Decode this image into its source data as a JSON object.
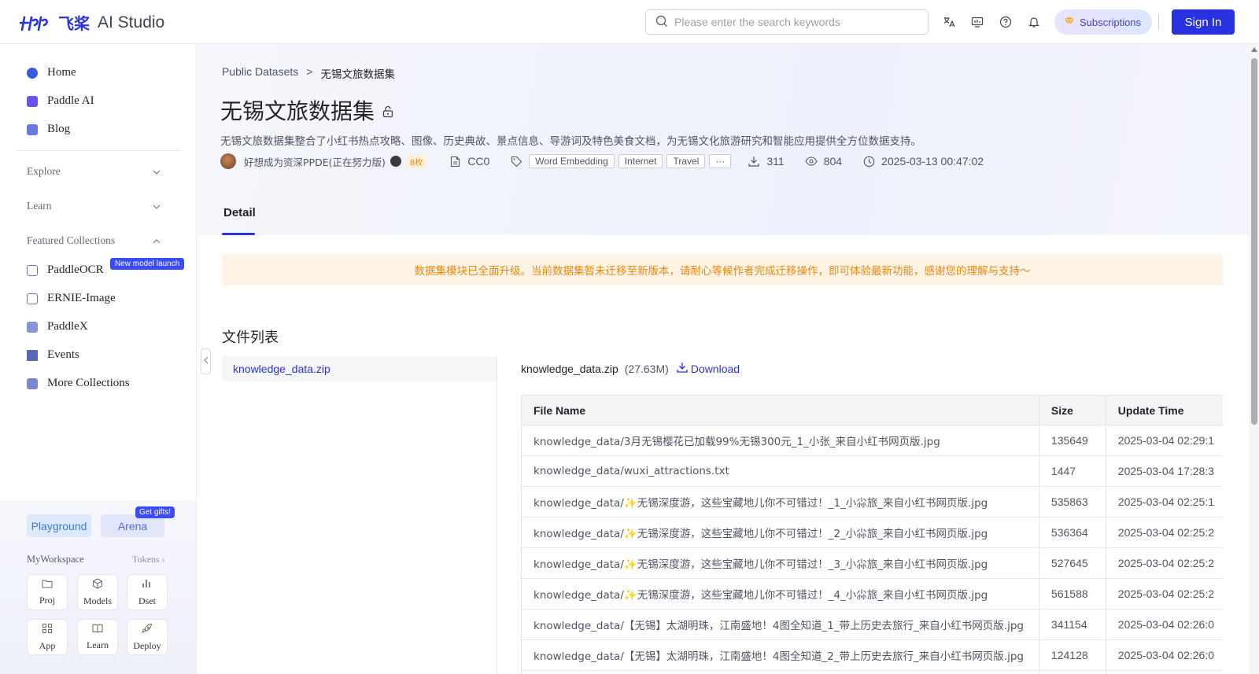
{
  "header": {
    "logo_cn": "飞桨",
    "logo_text": "AI Studio",
    "search_placeholder": "Please enter the search keywords",
    "subscriptions_label": "Subscriptions",
    "signin_label": "Sign In"
  },
  "sidebar": {
    "nav": [
      {
        "label": "Home",
        "icon": "home-icon",
        "color": "#3a5bd9"
      },
      {
        "label": "Paddle AI",
        "icon": "paddle-ai-icon",
        "color": "#6a54e8"
      },
      {
        "label": "Blog",
        "icon": "blog-icon",
        "color": "#6b78e0"
      }
    ],
    "sections": {
      "explore": "Explore",
      "learn": "Learn",
      "featured": "Featured Collections"
    },
    "featured_items": [
      {
        "label": "PaddleOCR",
        "icon": "paddleocr-icon"
      },
      {
        "label": "ERNIE-Image",
        "icon": "ernie-image-icon"
      },
      {
        "label": "PaddleX",
        "icon": "paddlex-icon"
      },
      {
        "label": "Events",
        "icon": "events-icon"
      },
      {
        "label": "More Collections",
        "icon": "more-collections-icon"
      }
    ],
    "new_badge": "New model launch",
    "playground_label": "Playground",
    "arena_label": "Arena",
    "gifts_badge": "Get gifts!",
    "workspace_label": "MyWorkspace",
    "tokens_label": "Tokens",
    "workspace_tiles": [
      "Proj",
      "Models",
      "Dset",
      "App",
      "Learn",
      "Deploy"
    ]
  },
  "breadcrumb": {
    "parent": "Public Datasets",
    "separator": ">",
    "current": "无锡文旅数据集"
  },
  "dataset": {
    "title": "无锡文旅数据集",
    "description": "无锡文旅数据集整合了小红书热点攻略、图像、历史典故、景点信息、导游词及特色美食文档，为无锡文化旅游研究和智能应用提供全方位数据支持。",
    "author": "好想成为资深PPDE(正在努力版)",
    "coins": "8枚",
    "license": "CC0",
    "tags": [
      "Word Embedding",
      "Internet",
      "Travel",
      "···"
    ],
    "downloads": "311",
    "views": "804",
    "updated": "2025-03-13 00:47:02"
  },
  "tabs": {
    "detail": "Detail"
  },
  "notice": "数据集模块已全面升级。当前数据集暂未迁移至新版本，请耐心等候作者完成迁移操作，即可体验最新功能，感谢您的理解与支持～",
  "files": {
    "section_title": "文件列表",
    "list": [
      "knowledge_data.zip"
    ],
    "selected_name": "knowledge_data.zip",
    "selected_size": "(27.63M)",
    "download_label": "Download",
    "columns": [
      "File Name",
      "Size",
      "Update Time"
    ],
    "rows": [
      [
        "knowledge_data/3月无锡樱花已加载99%无锡300元_1_小张_来自小红书网页版.jpg",
        "135649",
        "2025-03-04 02:29:1"
      ],
      [
        "knowledge_data/wuxi_attractions.txt",
        "1447",
        "2025-03-04 17:28:3"
      ],
      [
        "knowledge_data/✨无锡深度游，这些宝藏地儿你不可错过！_1_小尛旅_来自小红书网页版.jpg",
        "535863",
        "2025-03-04 02:25:1"
      ],
      [
        "knowledge_data/✨无锡深度游，这些宝藏地儿你不可错过！_2_小尛旅_来自小红书网页版.jpg",
        "536364",
        "2025-03-04 02:25:2"
      ],
      [
        "knowledge_data/✨无锡深度游，这些宝藏地儿你不可错过！_3_小尛旅_来自小红书网页版.jpg",
        "527645",
        "2025-03-04 02:25:2"
      ],
      [
        "knowledge_data/✨无锡深度游，这些宝藏地儿你不可错过！_4_小尛旅_来自小红书网页版.jpg",
        "561588",
        "2025-03-04 02:25:2"
      ],
      [
        "knowledge_data/【无锡】太湖明珠，江南盛地！4图全知道_1_带上历史去旅行_来自小红书网页版.jpg",
        "341154",
        "2025-03-04 02:26:0"
      ],
      [
        "knowledge_data/【无锡】太湖明珠，江南盛地！4图全知道_2_带上历史去旅行_来自小红书网页版.jpg",
        "124128",
        "2025-03-04 02:26:0"
      ],
      [
        "",
        "",
        ""
      ]
    ]
  },
  "colors": {
    "brand": "#2932e1",
    "notice_text": "#e8890f",
    "notice_bg": "#fff3e6"
  }
}
